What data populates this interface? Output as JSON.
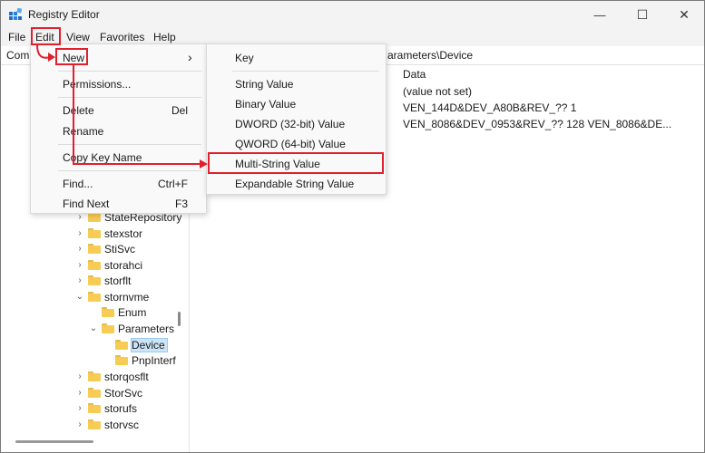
{
  "window": {
    "title": "Registry Editor"
  },
  "menubar": [
    "File",
    "Edit",
    "View",
    "Favorites",
    "Help"
  ],
  "address": {
    "left_fragment": "Com",
    "right_fragment": "arameters\\Device"
  },
  "tree": [
    {
      "label": "StateRepository",
      "expander": "›"
    },
    {
      "label": "stexstor",
      "expander": "›"
    },
    {
      "label": "StiSvc",
      "expander": "›"
    },
    {
      "label": "storahci",
      "expander": "›"
    },
    {
      "label": "storflt",
      "expander": "›"
    },
    {
      "label": "stornvme",
      "expander": "⌄"
    },
    {
      "label": "Enum",
      "expander": ""
    },
    {
      "label": "Parameters",
      "expander": "⌄"
    },
    {
      "label": "Device",
      "expander": ""
    },
    {
      "label": "PnpInterf",
      "expander": ""
    },
    {
      "label": "storqosflt",
      "expander": "›"
    },
    {
      "label": "StorSvc",
      "expander": "›"
    },
    {
      "label": "storufs",
      "expander": "›"
    },
    {
      "label": "storvsc",
      "expander": "›"
    }
  ],
  "values_pane": {
    "header_data": "Data",
    "rows": [
      "(value not set)",
      "VEN_144D&DEV_A80B&REV_?? 1",
      "VEN_8086&DEV_0953&REV_?? 128 VEN_8086&DE..."
    ]
  },
  "edit_menu": {
    "new": "New",
    "submenu_arrow": "›",
    "permissions": "Permissions...",
    "delete": "Delete",
    "delete_shortcut": "Del",
    "rename": "Rename",
    "copy_key_name": "Copy Key Name",
    "find": "Find...",
    "find_shortcut": "Ctrl+F",
    "find_next": "Find Next",
    "find_next_shortcut": "F3"
  },
  "new_submenu": [
    "Key",
    "String Value",
    "Binary Value",
    "DWORD (32-bit) Value",
    "QWORD (64-bit) Value",
    "Multi-String Value",
    "Expandable String Value"
  ],
  "window_controls": {
    "minimize": "—",
    "maximize": "☐",
    "close": "✕"
  },
  "colors": {
    "highlight": "#e0202e",
    "selection": "#cce4f7",
    "folder": "#f6cc55"
  }
}
